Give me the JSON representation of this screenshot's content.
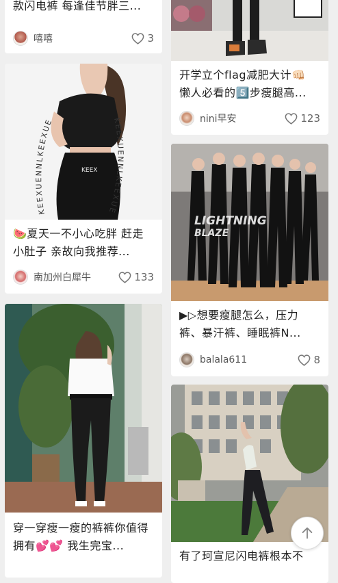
{
  "feed": {
    "cards": [
      {
        "title": "款闪电裤 每逢佳节胖三...",
        "author": "嘻嘻",
        "likes": "3"
      },
      {
        "title": "开学立个flag减肥大计👊🏻 懒人必看的5️⃣步瘦腿高...",
        "author": "nini早安",
        "likes": "123"
      },
      {
        "title": "🍉夏天一不小心吃胖 赶走小肚子 亲故向我推荐...",
        "author": "南加州白犀牛",
        "likes": "133",
        "photo_text": "KEEXUENNLKEEXUE"
      },
      {
        "title": "▶▷想要瘦腿怎么，压力裤、暴汗裤、睡眠裤N...",
        "author": "balala611",
        "likes": "8",
        "photo_text_1": "LIGHTNING",
        "photo_text_2": "BLAZE"
      },
      {
        "title": "穿一穿瘦一瘦的裤裤你值得拥有💕💕 我生完宝...",
        "author": "",
        "likes": ""
      },
      {
        "title": "有了珂宣尼闪电裤根本不",
        "author": "",
        "likes": ""
      }
    ]
  },
  "colors": {
    "background": "#efefef",
    "card": "#ffffff",
    "text": "#222222",
    "meta": "#555555"
  },
  "icons": {
    "like": "heart-outline-icon",
    "scroll_top": "arrow-up-icon"
  }
}
